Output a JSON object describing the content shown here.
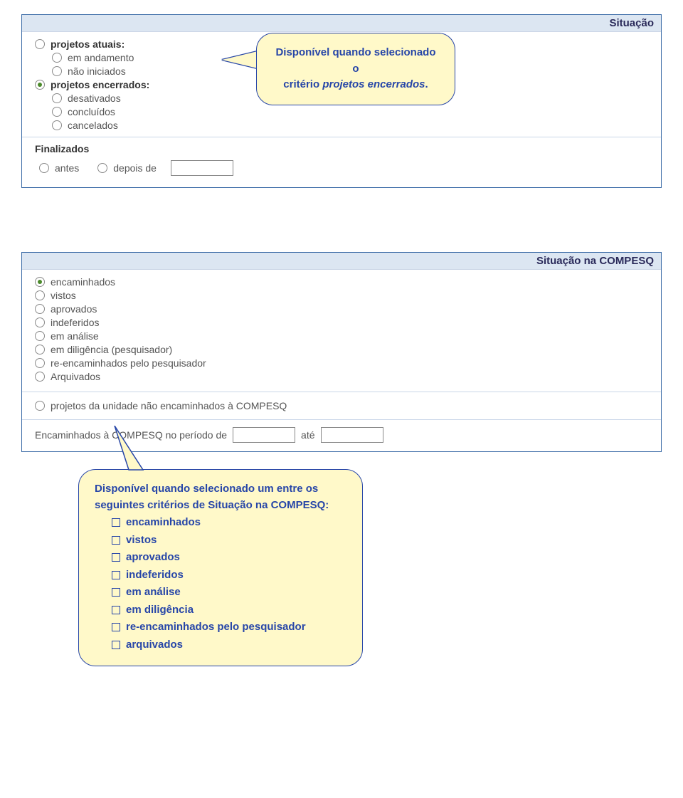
{
  "panel1": {
    "header": "Situação",
    "groups": {
      "atuais": {
        "label": "projetos atuais:",
        "opts": [
          "em andamento",
          "não iniciados"
        ]
      },
      "encerrados": {
        "label": "projetos encerrados:",
        "opts": [
          "desativados",
          "concluídos",
          "cancelados"
        ]
      }
    },
    "finalizados": {
      "label": "Finalizados",
      "antes": "antes",
      "depois": "depois de"
    }
  },
  "callout1": {
    "line1": "Disponível quando selecionado o",
    "line2_pre": "critério ",
    "line2_it": "projetos encerrados",
    "line2_post": "."
  },
  "panel2": {
    "header": "Situação na COMPESQ",
    "opts": [
      "encaminhados",
      "vistos",
      "aprovados",
      "indeferidos",
      "em análise",
      "em diligência (pesquisador)",
      "re-encaminhados pelo pesquisador",
      "Arquivados"
    ],
    "sep_opt": "projetos da unidade não encaminhados à COMPESQ",
    "periodo_pre": "Encaminhados à COMPESQ no período de",
    "ate": "até"
  },
  "callout2": {
    "lead": "Disponível quando selecionado um entre os seguintes critérios de Situação na COMPESQ:",
    "items": [
      "encaminhados",
      "vistos",
      "aprovados",
      "indeferidos",
      "em análise",
      "em diligência",
      "re-encaminhados pelo pesquisador",
      "arquivados"
    ]
  }
}
